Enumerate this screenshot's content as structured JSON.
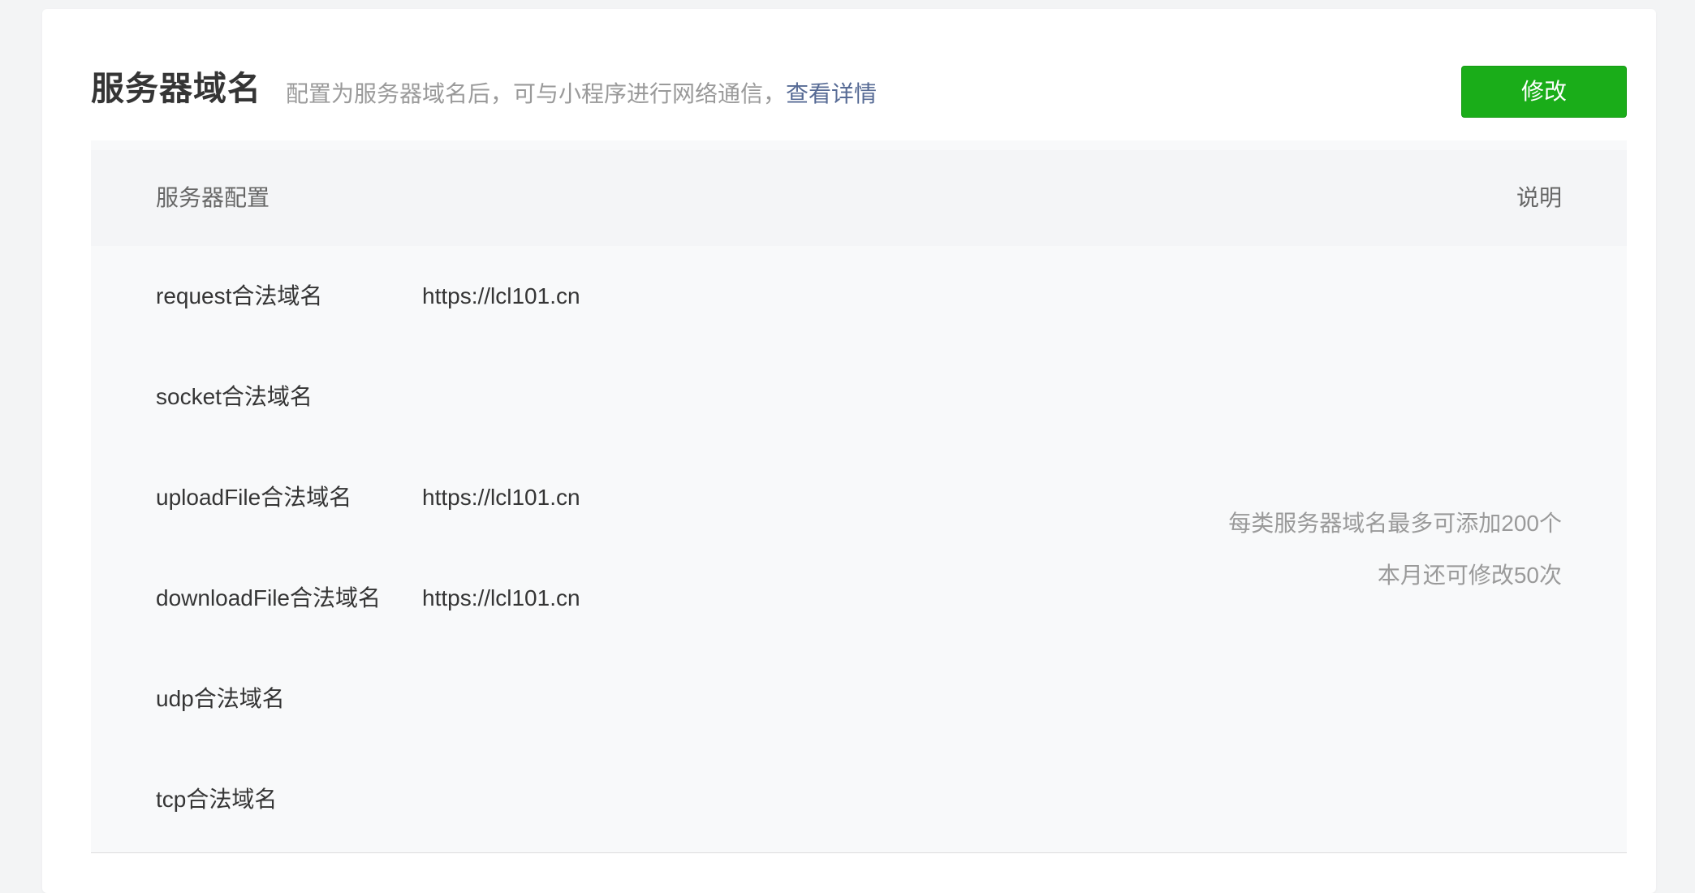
{
  "header": {
    "title": "服务器域名",
    "subtitle": "配置为服务器域名后，可与小程序进行网络通信，",
    "details_link": "查看详情",
    "edit_button": "修改"
  },
  "table": {
    "columns": {
      "config": "服务器配置",
      "description": "说明"
    },
    "rows": [
      {
        "label": "request合法域名",
        "value": "https://lcl101.cn"
      },
      {
        "label": "socket合法域名",
        "value": ""
      },
      {
        "label": "uploadFile合法域名",
        "value": "https://lcl101.cn"
      },
      {
        "label": "downloadFile合法域名",
        "value": "https://lcl101.cn"
      },
      {
        "label": "udp合法域名",
        "value": ""
      },
      {
        "label": "tcp合法域名",
        "value": ""
      }
    ],
    "description": [
      "每类服务器域名最多可添加200个",
      "本月还可修改50次"
    ]
  },
  "colors": {
    "primary_button": "#1aad19",
    "link": "#576b95",
    "muted_text": "#9a9a9a",
    "table_background": "#f8f9fa"
  }
}
